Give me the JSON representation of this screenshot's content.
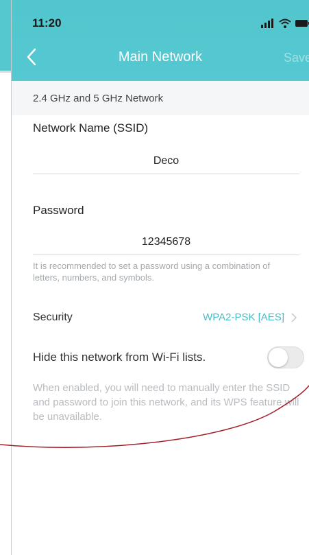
{
  "status_bar": {
    "time": "11:20"
  },
  "nav": {
    "title": "Main Network",
    "save_label": "Save"
  },
  "section": {
    "header": "2.4 GHz and 5 GHz Network"
  },
  "ssid": {
    "label": "Network Name (SSID)",
    "value": "Deco"
  },
  "password": {
    "label": "Password",
    "value": "12345678",
    "hint": "It is recommended to set a password using a combination of letters, numbers, and symbols."
  },
  "security": {
    "label": "Security",
    "value": "WPA2-PSK [AES]"
  },
  "hide_network": {
    "label": "Hide this network from Wi-Fi lists.",
    "enabled": false,
    "note": "When enabled, you will need to manually enter the SSID and password to join this network, and its WPS feature will be unavailable."
  },
  "colors": {
    "accent": "#55c7cf",
    "link": "#47bfc9",
    "annotation": "#a3202a"
  },
  "icons": [
    "back-chevron-icon",
    "signal-icon",
    "wifi-icon",
    "battery-icon",
    "chevron-right-icon"
  ]
}
